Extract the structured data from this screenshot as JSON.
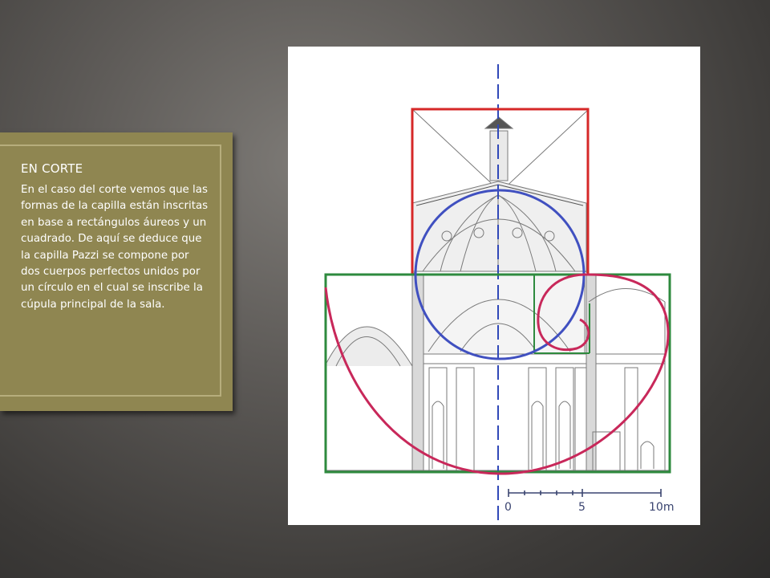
{
  "panel": {
    "title": "EN CORTE",
    "body": "En el caso del corte vemos que las formas de la capilla están inscritas en base a rectángulos áureos y un cuadrado. De aquí se deduce que la capilla Pazzi se compone por dos cuerpos perfectos unidos por un círculo en el cual se inscribe la cúpula principal de la sala."
  },
  "drawing": {
    "scale_labels": [
      "0",
      "5",
      "10m"
    ],
    "colors": {
      "square": "#d62828",
      "golden_rectangle": "#2e8a3e",
      "circle": "#4050c0",
      "spiral": "#c8285a",
      "axis": "#3048b8",
      "pencil": "#777777",
      "scale": "#3a4470"
    }
  }
}
